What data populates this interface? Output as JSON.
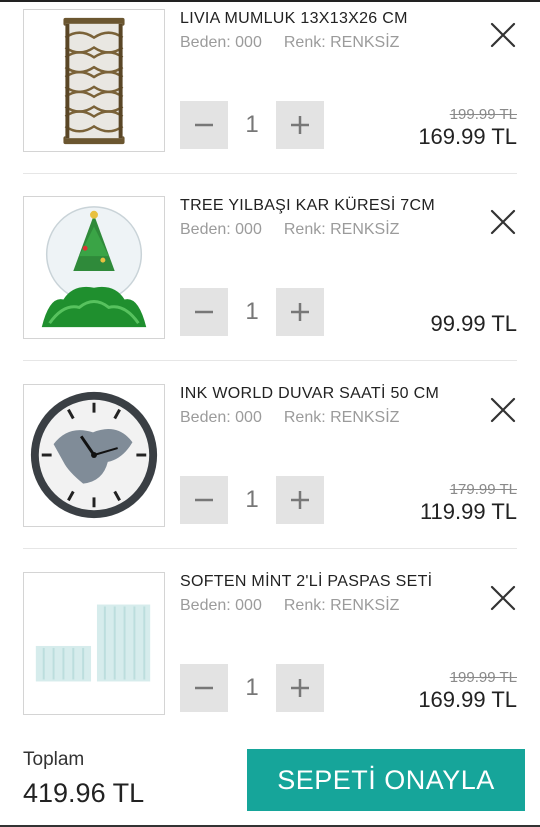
{
  "cart": {
    "items": [
      {
        "name": "LIVIA MUMLUK 13X13X26 CM",
        "size": "Beden: 000",
        "color": "Renk: RENKSİZ",
        "quantity": "1",
        "old_price": "199.99 TL",
        "price": "169.99 TL",
        "image_icon": "lantern-image"
      },
      {
        "name": "TREE YILBAŞI KAR KÜRESİ 7CM",
        "size": "Beden: 000",
        "color": "Renk: RENKSİZ",
        "quantity": "1",
        "old_price": "",
        "price": "99.99 TL",
        "image_icon": "snow-globe-image"
      },
      {
        "name": "INK WORLD DUVAR SAATİ 50 CM",
        "size": "Beden: 000",
        "color": "Renk: RENKSİZ",
        "quantity": "1",
        "old_price": "179.99 TL",
        "price": "119.99 TL",
        "image_icon": "wall-clock-image"
      },
      {
        "name": "SOFTEN MİNT 2'Lİ PASPAS SETİ",
        "size": "Beden: 000",
        "color": "Renk: RENKSİZ",
        "quantity": "1",
        "old_price": "199.99 TL",
        "price": "169.99 TL",
        "image_icon": "bath-mat-image"
      }
    ]
  },
  "footer": {
    "total_label": "Toplam",
    "total_value": "419.96 TL",
    "confirm_label": "SEPETİ ONAYLA"
  },
  "colors": {
    "accent": "#16a59a",
    "qty_button_bg": "#e3e3e3",
    "muted_text": "#9b9b9b"
  },
  "icons": {
    "remove": "close-icon",
    "decrease": "minus-icon",
    "increase": "plus-icon"
  }
}
